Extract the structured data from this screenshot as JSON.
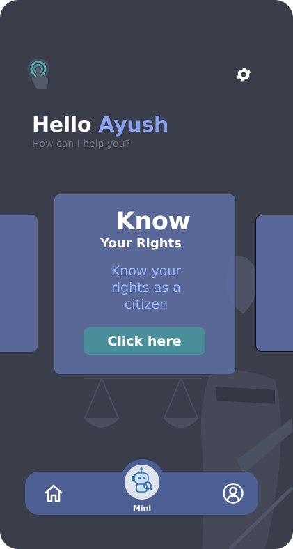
{
  "header": {
    "logo_icon": "touch-fingerprint-icon",
    "settings_icon": "gear-icon"
  },
  "greeting": {
    "hello": "Hello",
    "name": "Ayush",
    "subtitle": "How can I help you?"
  },
  "carousel": {
    "card": {
      "title": "Know",
      "subtitle": "Your Rights",
      "description_lines": [
        "Know your",
        "rights as a",
        "citizen"
      ],
      "button_label": "Click here"
    }
  },
  "bottom_nav": {
    "home_icon": "home-icon",
    "center_label": "Mini",
    "center_icon": "robot-assistant-icon",
    "profile_icon": "user-circle-icon"
  },
  "colors": {
    "background": "#3a3d4a",
    "accent_name": "#8aa1f0",
    "card": "#5d6b9e",
    "button": "#4a8e9a",
    "nav": "#4e5f93"
  }
}
